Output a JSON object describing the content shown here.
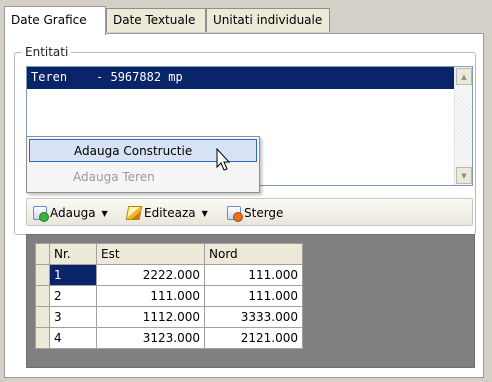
{
  "tabs": [
    {
      "label": "Date Grafice"
    },
    {
      "label": "Date Textuale"
    },
    {
      "label": "Unitati individuale"
    }
  ],
  "entities_group": {
    "legend": "Entitati",
    "items": [
      {
        "label": "Teren    - 5967882 mp"
      }
    ]
  },
  "context_menu": {
    "items": [
      {
        "label": "Adauga Constructie",
        "state": "hover"
      },
      {
        "label": "Adauga Teren",
        "state": "disabled"
      }
    ]
  },
  "toolbar": {
    "add_label": "Adauga",
    "edit_label": "Editeaza",
    "delete_label": "Sterge"
  },
  "grid": {
    "columns": [
      "Nr.",
      "Est",
      "Nord"
    ],
    "rows": [
      {
        "nr": "1",
        "est": "2222.000",
        "nord": "111.000"
      },
      {
        "nr": "2",
        "est": "111.000",
        "nord": "111.000"
      },
      {
        "nr": "3",
        "est": "1112.000",
        "nord": "3333.000"
      },
      {
        "nr": "4",
        "est": "3123.000",
        "nord": "2121.000"
      }
    ]
  },
  "colors": {
    "selection": "#0a246a",
    "menu_hover": "#d7e3f5",
    "background": "#d4d0c8"
  }
}
